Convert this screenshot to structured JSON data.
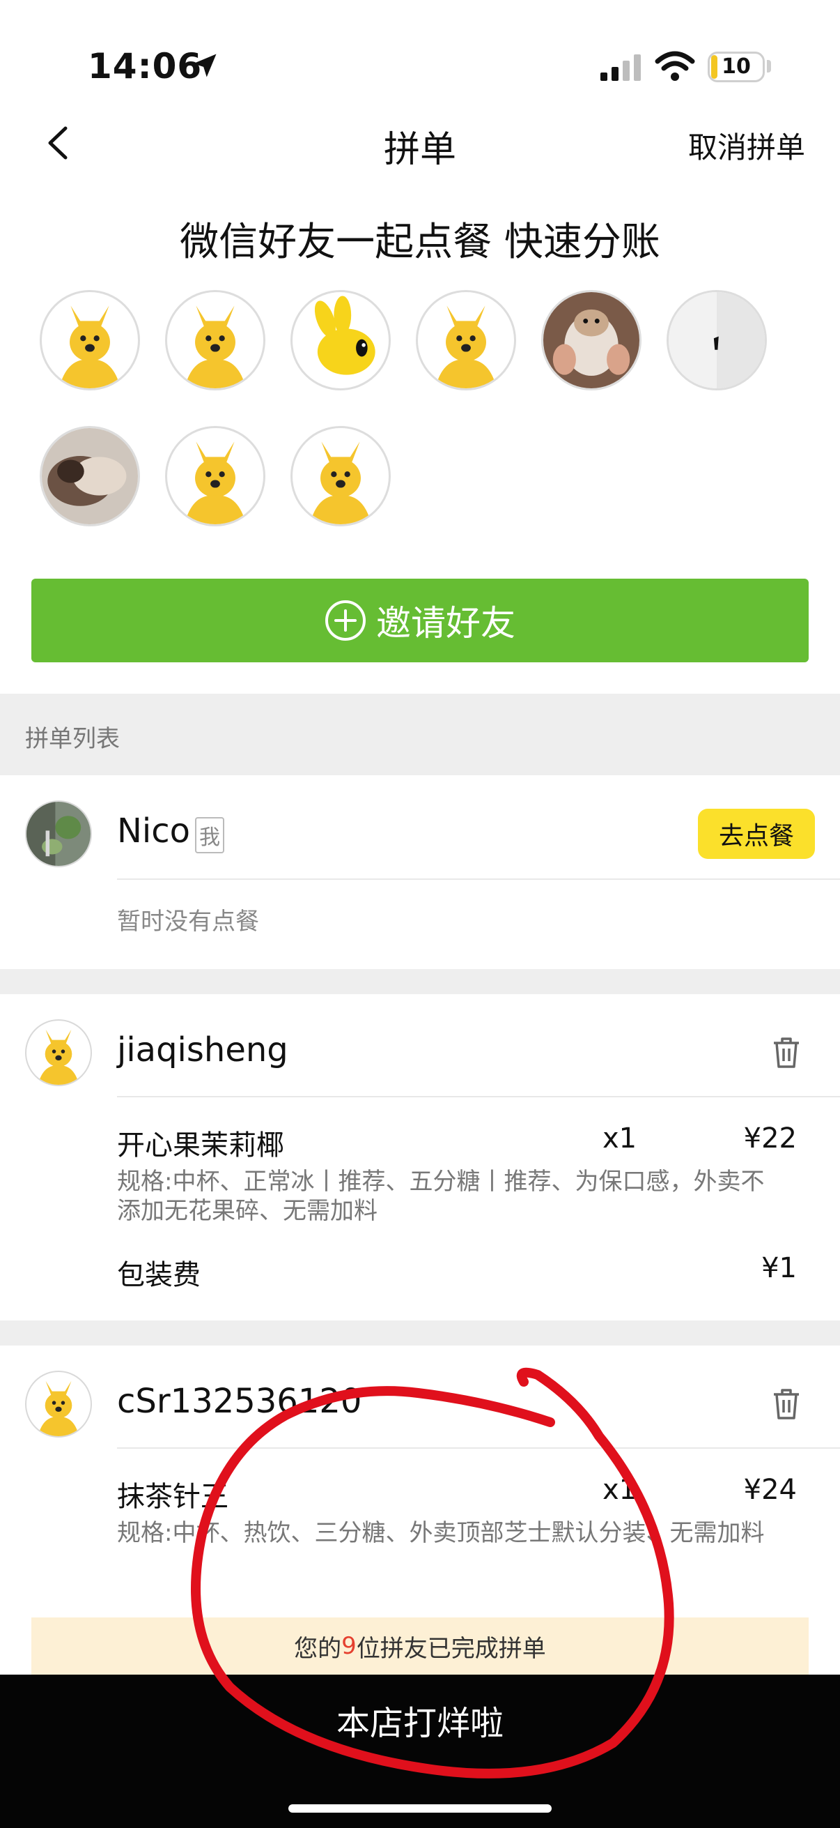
{
  "status_bar": {
    "time": "14:06",
    "battery": "10"
  },
  "nav": {
    "title": "拼单",
    "cancel": "取消拼单"
  },
  "subtitle": "微信好友一起点餐 快速分账",
  "invite": {
    "label": "邀请好友"
  },
  "list_header": "拼单列表",
  "members": [
    {
      "name": "Nico",
      "tag": "我",
      "button": "去点餐",
      "empty_text": "暂时没有点餐"
    },
    {
      "name": "jiaqisheng",
      "items": [
        {
          "name": "开心果茉莉椰",
          "qty": "x1",
          "price": "¥22",
          "spec": "规格:中杯、正常冰丨推荐、五分糖丨推荐、为保口感，外卖不添加无花果碎、无需加料"
        }
      ],
      "packaging": {
        "label": "包装费",
        "price": "¥1"
      }
    },
    {
      "name": "cSr132536120",
      "items": [
        {
          "name": "抹茶针王",
          "qty": "x1",
          "price": "¥24",
          "spec": "规格:中杯、热饮、三分糖、外卖顶部芝士默认分装、无需加料"
        }
      ]
    }
  ],
  "notice": {
    "prefix": "您的",
    "count": "9",
    "suffix": "位拼友已完成拼单"
  },
  "bottom": {
    "text": "本店打烊啦"
  },
  "colors": {
    "invite_green": "#66bd33",
    "order_yellow": "#fbe02b",
    "annotation_red": "#e0101c"
  }
}
